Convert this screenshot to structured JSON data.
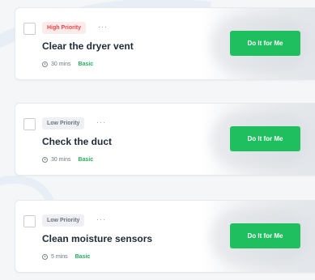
{
  "tasks": [
    {
      "priority": "High Priority",
      "more": "···",
      "title": "Clear the dryer vent",
      "duration": "30 mins",
      "level": "Basic",
      "action": "Do It for Me"
    },
    {
      "priority": "Low Priority",
      "more": "···",
      "title": "Check the duct",
      "duration": "30 mins",
      "level": "Basic",
      "action": "Do It for Me"
    },
    {
      "priority": "Low Priority",
      "more": "···",
      "title": "Clean moisture sensors",
      "duration": "5 mins",
      "level": "Basic",
      "action": "Do It for Me"
    }
  ],
  "colors": {
    "high_priority_text": "#e04848",
    "high_priority_bg": "#fdeaea",
    "low_priority_bg": "#eef0f3",
    "level_text": "#22b45a",
    "cta_bg": "#1fbf5f"
  },
  "icons": {
    "duration": "clock-icon",
    "more": "more-horizontal-icon"
  }
}
